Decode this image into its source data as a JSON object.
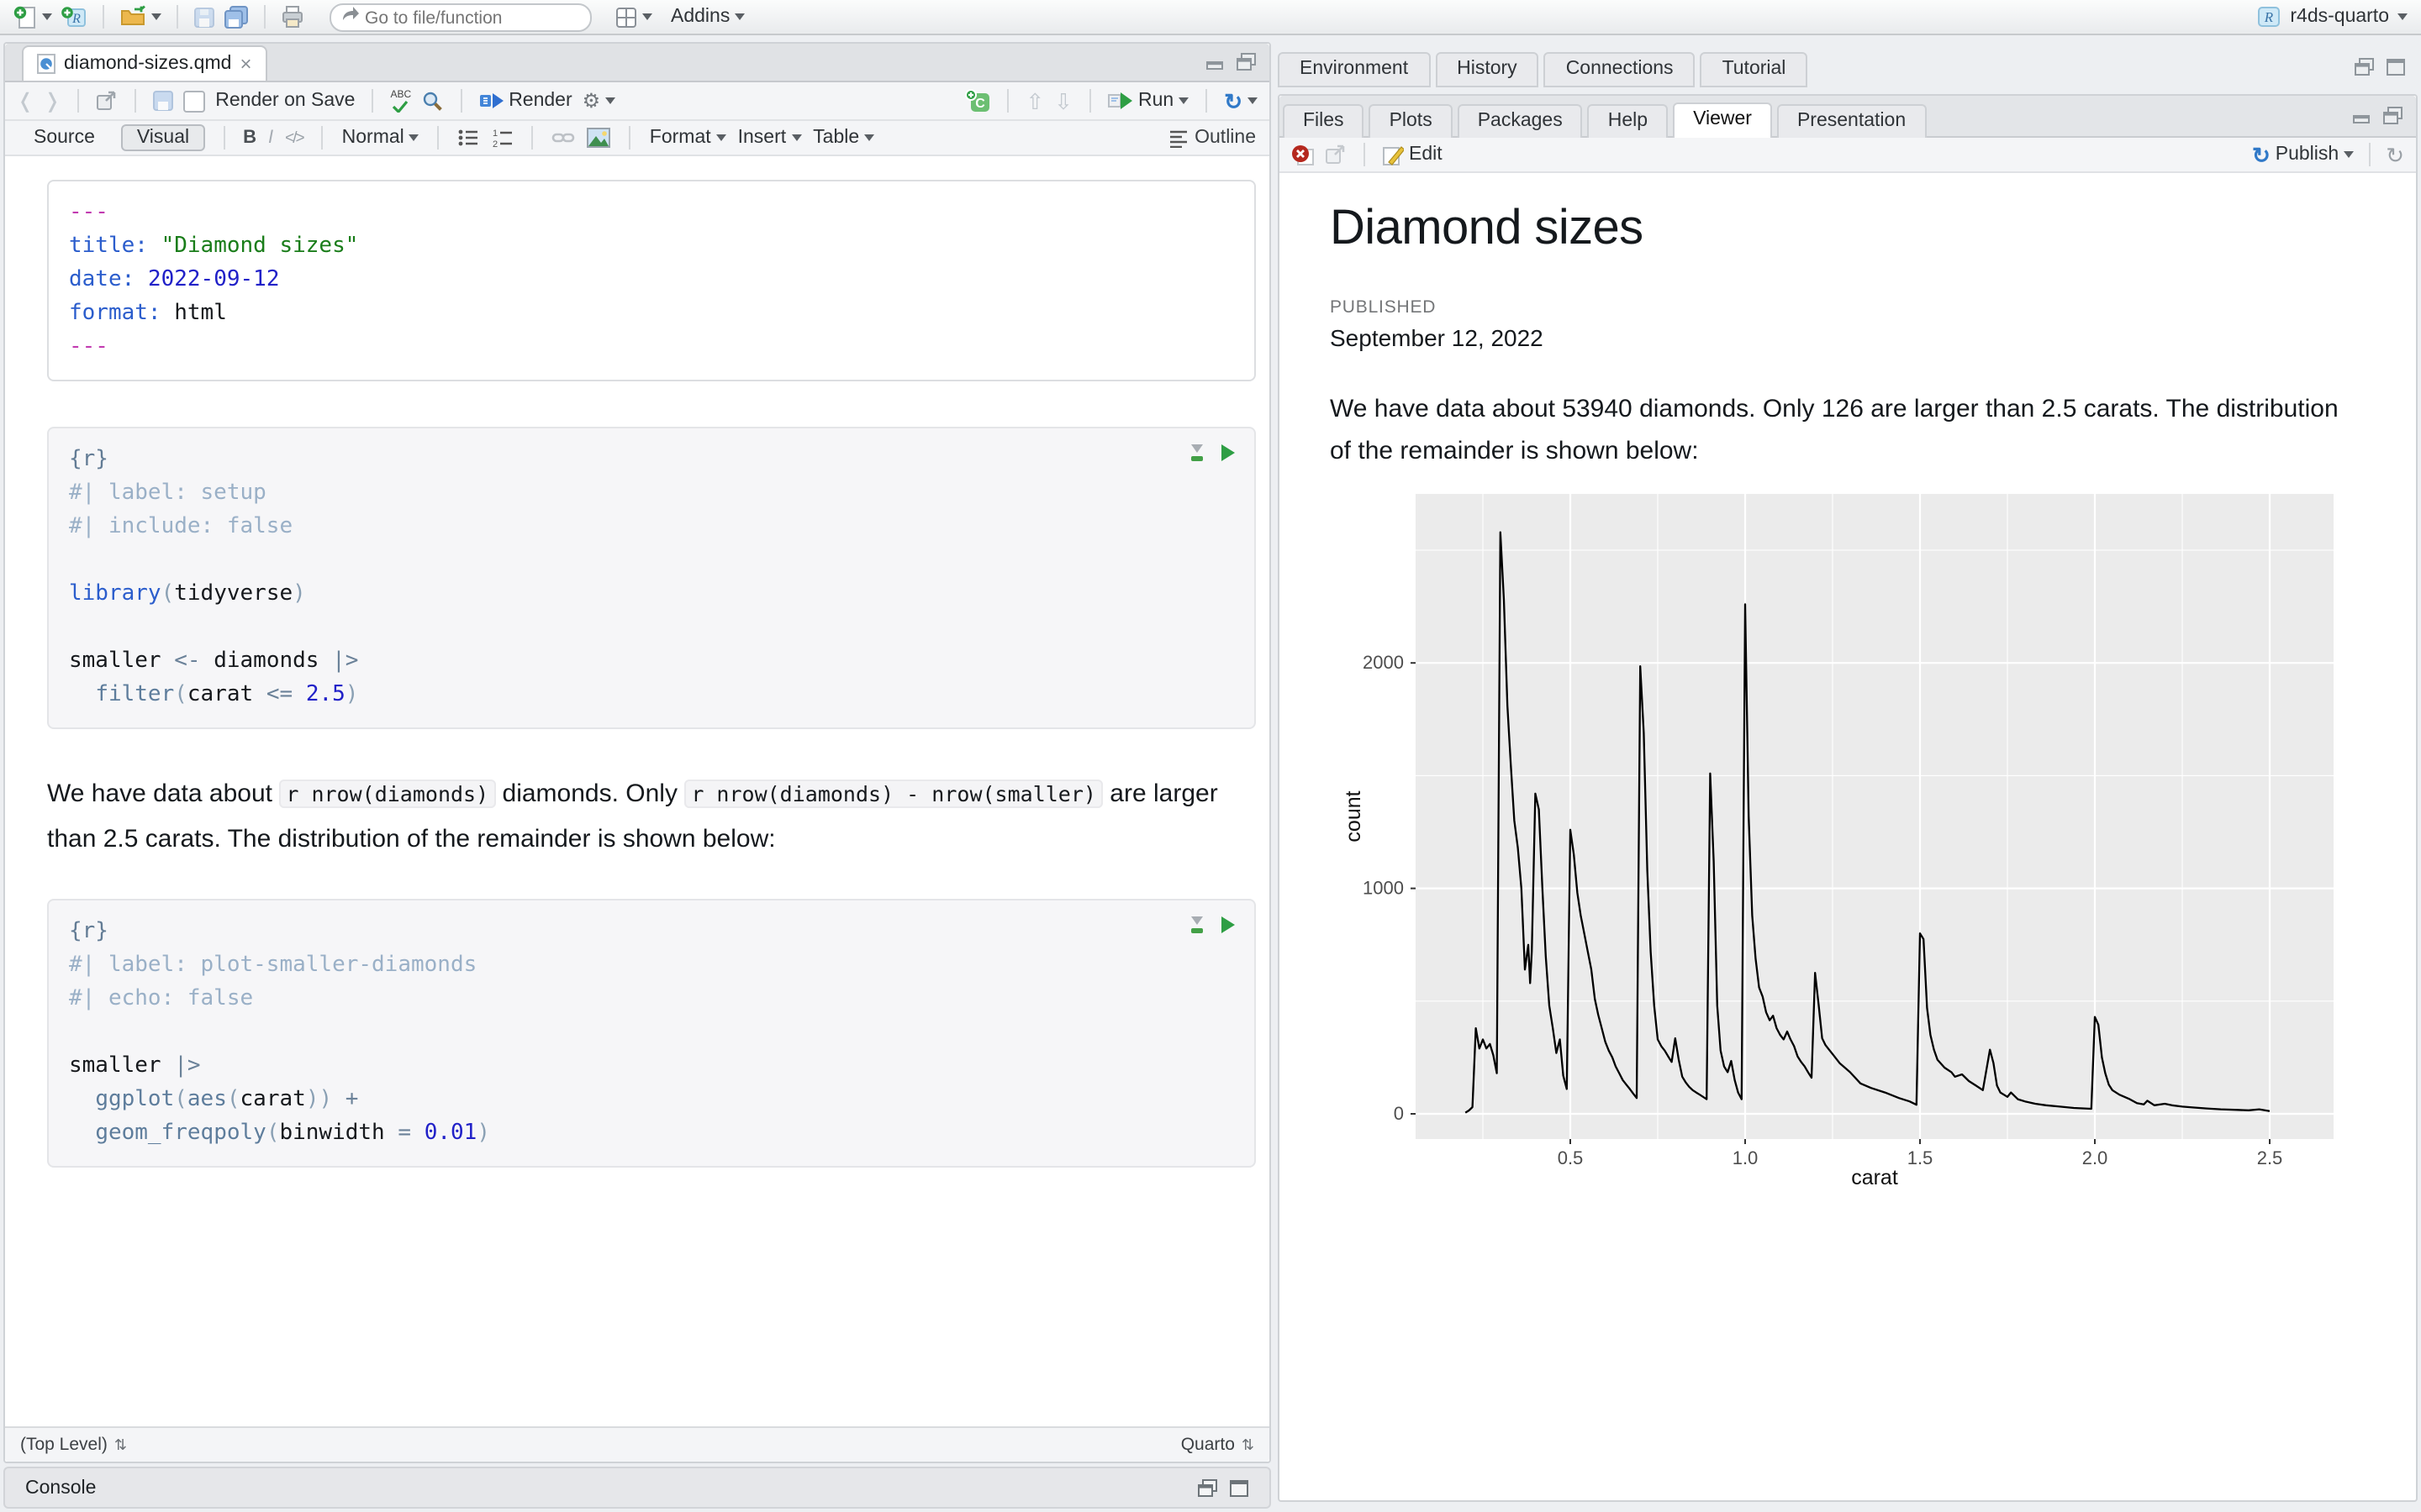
{
  "main_toolbar": {
    "goto_placeholder": "Go to file/function",
    "addins_label": "Addins",
    "project_name": "r4ds-quarto"
  },
  "editor_pane": {
    "tab_label": "diamond-sizes.qmd",
    "close_glyph": "×",
    "toolbar": {
      "render_on_save": "Render on Save",
      "render": "Render",
      "run": "Run"
    },
    "format_bar": {
      "source": "Source",
      "visual": "Visual",
      "bold": "B",
      "italic": "I",
      "code_glyph": "</>",
      "paragraph_style": "Normal",
      "format": "Format",
      "insert": "Insert",
      "table": "Table",
      "outline": "Outline"
    },
    "yaml_lines": [
      [
        [
          "delim",
          "---"
        ]
      ],
      [
        [
          "key",
          "title:"
        ],
        [
          "plain",
          " "
        ],
        [
          "str",
          "\"Diamond sizes\""
        ]
      ],
      [
        [
          "key",
          "date:"
        ],
        [
          "plain",
          " "
        ],
        [
          "num",
          "2022-09-12"
        ]
      ],
      [
        [
          "key",
          "format:"
        ],
        [
          "plain",
          " "
        ],
        [
          "plain",
          "html"
        ]
      ],
      [
        [
          "delim",
          "---"
        ]
      ]
    ],
    "chunk1_lines": [
      [
        [
          "brace",
          "{r}"
        ]
      ],
      [
        [
          "comment",
          "#| label: setup"
        ]
      ],
      [
        [
          "comment",
          "#| include: false"
        ]
      ],
      [],
      [
        [
          "fnblue",
          "library"
        ],
        [
          "paren",
          "("
        ],
        [
          "plain",
          "tidyverse"
        ],
        [
          "paren",
          ")"
        ]
      ],
      [],
      [
        [
          "plain",
          "smaller "
        ],
        [
          "op",
          "<-"
        ],
        [
          "plain",
          " diamonds "
        ],
        [
          "op",
          "|>"
        ]
      ],
      [
        [
          "plain",
          "  "
        ],
        [
          "fn",
          "filter"
        ],
        [
          "paren",
          "("
        ],
        [
          "plain",
          "carat "
        ],
        [
          "op",
          "<="
        ],
        [
          "plain",
          " "
        ],
        [
          "num",
          "2.5"
        ],
        [
          "paren",
          ")"
        ]
      ]
    ],
    "paragraph": [
      {
        "t": "We have data about "
      },
      {
        "t": "r nrow(diamonds)",
        "code": true
      },
      {
        "t": " diamonds. Only "
      },
      {
        "t": "r nrow(diamonds) - nrow(smaller)",
        "code": true
      },
      {
        "t": " are larger than 2.5 carats. The distribution of the remainder is shown below:"
      }
    ],
    "chunk2_lines": [
      [
        [
          "brace",
          "{r}"
        ]
      ],
      [
        [
          "comment",
          "#| label: plot-smaller-diamonds"
        ]
      ],
      [
        [
          "comment",
          "#| echo: false"
        ]
      ],
      [],
      [
        [
          "plain",
          "smaller "
        ],
        [
          "op",
          "|>"
        ]
      ],
      [
        [
          "plain",
          "  "
        ],
        [
          "fn",
          "ggplot"
        ],
        [
          "paren",
          "("
        ],
        [
          "fn",
          "aes"
        ],
        [
          "paren",
          "("
        ],
        [
          "plain",
          "carat"
        ],
        [
          "paren",
          "))"
        ],
        [
          "plain",
          " "
        ],
        [
          "op",
          "+"
        ]
      ],
      [
        [
          "plain",
          "  "
        ],
        [
          "fn",
          "geom_freqpoly"
        ],
        [
          "paren",
          "("
        ],
        [
          "plain",
          "binwidth "
        ],
        [
          "op",
          "="
        ],
        [
          "plain",
          " "
        ],
        [
          "num",
          "0.01"
        ],
        [
          "paren",
          ")"
        ]
      ]
    ],
    "status_left": "(Top Level)",
    "status_right": "Quarto",
    "console_label": "Console"
  },
  "right_panes": {
    "top_tabs": [
      "Environment",
      "History",
      "Connections",
      "Tutorial"
    ],
    "bottom_tabs": [
      "Files",
      "Plots",
      "Packages",
      "Help",
      "Viewer",
      "Presentation"
    ],
    "viewer_toolbar": {
      "edit": "Edit",
      "publish": "Publish"
    }
  },
  "viewer_doc": {
    "title": "Diamond sizes",
    "published_label": "PUBLISHED",
    "published_date": "September 12, 2022",
    "paragraph": "We have data about 53940 diamonds. Only 126 are larger than 2.5 carats. The distribution of the remainder is shown below:"
  },
  "icons": {
    "updown": "⇅",
    "gear": "⚙",
    "refresh": "↻",
    "publish": "↻",
    "pencil": "✎",
    "back": "❬",
    "forward": "❭"
  },
  "chart_data": {
    "type": "line",
    "geom": "freqpoly",
    "title": "",
    "xlabel": "carat",
    "ylabel": "count",
    "x_ticks": [
      0.5,
      1.0,
      1.5,
      2.0,
      2.5
    ],
    "x_tick_labels": [
      "0.5",
      "1.0",
      "1.5",
      "2.0",
      "2.5"
    ],
    "y_ticks": [
      0,
      1000,
      2000
    ],
    "y_tick_labels": [
      "0",
      "1000",
      "2000"
    ],
    "x_minor": [
      0.25,
      0.75,
      1.25,
      1.75,
      2.25
    ],
    "y_minor": [
      500,
      1500,
      2500
    ],
    "xlim": [
      0.06,
      2.68
    ],
    "ylim": [
      -110,
      2750
    ],
    "grid": "#ffffff",
    "panel_bg": "#ebebeb",
    "line_color": "#000000",
    "points": [
      [
        0.2,
        5
      ],
      [
        0.21,
        15
      ],
      [
        0.22,
        30
      ],
      [
        0.23,
        380
      ],
      [
        0.24,
        290
      ],
      [
        0.25,
        330
      ],
      [
        0.26,
        290
      ],
      [
        0.27,
        310
      ],
      [
        0.28,
        260
      ],
      [
        0.29,
        180
      ],
      [
        0.3,
        2580
      ],
      [
        0.31,
        2280
      ],
      [
        0.32,
        1810
      ],
      [
        0.33,
        1550
      ],
      [
        0.34,
        1300
      ],
      [
        0.35,
        1180
      ],
      [
        0.36,
        1000
      ],
      [
        0.37,
        640
      ],
      [
        0.38,
        750
      ],
      [
        0.385,
        580
      ],
      [
        0.39,
        720
      ],
      [
        0.4,
        1420
      ],
      [
        0.41,
        1350
      ],
      [
        0.42,
        1000
      ],
      [
        0.43,
        700
      ],
      [
        0.44,
        480
      ],
      [
        0.45,
        380
      ],
      [
        0.46,
        270
      ],
      [
        0.47,
        330
      ],
      [
        0.48,
        170
      ],
      [
        0.49,
        110
      ],
      [
        0.5,
        1260
      ],
      [
        0.51,
        1150
      ],
      [
        0.52,
        980
      ],
      [
        0.53,
        880
      ],
      [
        0.54,
        800
      ],
      [
        0.55,
        720
      ],
      [
        0.56,
        640
      ],
      [
        0.57,
        510
      ],
      [
        0.58,
        440
      ],
      [
        0.59,
        380
      ],
      [
        0.6,
        320
      ],
      [
        0.61,
        280
      ],
      [
        0.62,
        250
      ],
      [
        0.63,
        210
      ],
      [
        0.64,
        180
      ],
      [
        0.65,
        150
      ],
      [
        0.66,
        130
      ],
      [
        0.67,
        110
      ],
      [
        0.68,
        90
      ],
      [
        0.69,
        70
      ],
      [
        0.7,
        1985
      ],
      [
        0.71,
        1690
      ],
      [
        0.72,
        1080
      ],
      [
        0.73,
        720
      ],
      [
        0.74,
        480
      ],
      [
        0.75,
        330
      ],
      [
        0.76,
        300
      ],
      [
        0.77,
        280
      ],
      [
        0.78,
        255
      ],
      [
        0.79,
        230
      ],
      [
        0.8,
        335
      ],
      [
        0.81,
        240
      ],
      [
        0.82,
        165
      ],
      [
        0.83,
        140
      ],
      [
        0.84,
        120
      ],
      [
        0.85,
        105
      ],
      [
        0.86,
        95
      ],
      [
        0.87,
        85
      ],
      [
        0.88,
        75
      ],
      [
        0.89,
        65
      ],
      [
        0.9,
        1510
      ],
      [
        0.91,
        1120
      ],
      [
        0.92,
        480
      ],
      [
        0.93,
        280
      ],
      [
        0.94,
        210
      ],
      [
        0.95,
        185
      ],
      [
        0.96,
        235
      ],
      [
        0.97,
        150
      ],
      [
        0.98,
        95
      ],
      [
        0.99,
        65
      ],
      [
        1.0,
        2260
      ],
      [
        1.01,
        1320
      ],
      [
        1.02,
        880
      ],
      [
        1.03,
        690
      ],
      [
        1.04,
        560
      ],
      [
        1.05,
        520
      ],
      [
        1.06,
        450
      ],
      [
        1.07,
        415
      ],
      [
        1.08,
        435
      ],
      [
        1.09,
        380
      ],
      [
        1.1,
        350
      ],
      [
        1.11,
        330
      ],
      [
        1.12,
        365
      ],
      [
        1.13,
        330
      ],
      [
        1.14,
        300
      ],
      [
        1.15,
        255
      ],
      [
        1.16,
        230
      ],
      [
        1.17,
        210
      ],
      [
        1.18,
        185
      ],
      [
        1.19,
        160
      ],
      [
        1.2,
        625
      ],
      [
        1.21,
        485
      ],
      [
        1.22,
        335
      ],
      [
        1.23,
        305
      ],
      [
        1.24,
        285
      ],
      [
        1.25,
        265
      ],
      [
        1.27,
        225
      ],
      [
        1.3,
        185
      ],
      [
        1.33,
        135
      ],
      [
        1.36,
        115
      ],
      [
        1.4,
        95
      ],
      [
        1.44,
        70
      ],
      [
        1.47,
        55
      ],
      [
        1.49,
        40
      ],
      [
        1.5,
        800
      ],
      [
        1.51,
        775
      ],
      [
        1.52,
        470
      ],
      [
        1.53,
        350
      ],
      [
        1.54,
        285
      ],
      [
        1.55,
        240
      ],
      [
        1.57,
        205
      ],
      [
        1.59,
        185
      ],
      [
        1.6,
        165
      ],
      [
        1.62,
        175
      ],
      [
        1.64,
        145
      ],
      [
        1.66,
        125
      ],
      [
        1.68,
        105
      ],
      [
        1.7,
        285
      ],
      [
        1.71,
        225
      ],
      [
        1.72,
        125
      ],
      [
        1.73,
        95
      ],
      [
        1.74,
        85
      ],
      [
        1.75,
        75
      ],
      [
        1.76,
        95
      ],
      [
        1.78,
        65
      ],
      [
        1.8,
        55
      ],
      [
        1.83,
        45
      ],
      [
        1.86,
        38
      ],
      [
        1.9,
        32
      ],
      [
        1.94,
        26
      ],
      [
        1.99,
        22
      ],
      [
        2.0,
        430
      ],
      [
        2.01,
        395
      ],
      [
        2.02,
        250
      ],
      [
        2.03,
        180
      ],
      [
        2.04,
        130
      ],
      [
        2.05,
        105
      ],
      [
        2.07,
        85
      ],
      [
        2.1,
        65
      ],
      [
        2.12,
        48
      ],
      [
        2.14,
        42
      ],
      [
        2.15,
        58
      ],
      [
        2.17,
        38
      ],
      [
        2.2,
        45
      ],
      [
        2.22,
        38
      ],
      [
        2.25,
        32
      ],
      [
        2.28,
        28
      ],
      [
        2.32,
        24
      ],
      [
        2.36,
        20
      ],
      [
        2.4,
        18
      ],
      [
        2.44,
        16
      ],
      [
        2.47,
        20
      ],
      [
        2.5,
        12
      ]
    ]
  }
}
